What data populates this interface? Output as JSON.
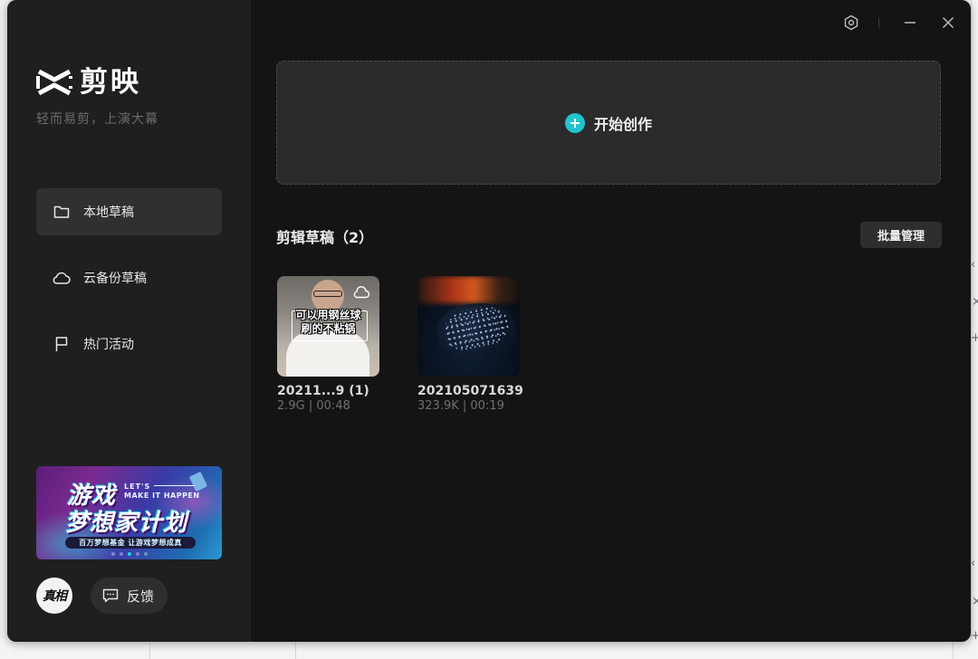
{
  "app": {
    "name": "剪映",
    "slogan": "轻而易剪，上演大幕"
  },
  "sidebar": {
    "items": [
      {
        "label": "本地草稿",
        "icon": "folder-icon",
        "active": true
      },
      {
        "label": "云备份草稿",
        "icon": "cloud-icon",
        "active": false
      },
      {
        "label": "热门活动",
        "icon": "flag-icon",
        "active": false
      }
    ],
    "banner": {
      "title_line1": "游戏",
      "title_line2": "梦想家计划",
      "english_line1": "LET'S",
      "english_line2": "MAKE IT HAPPEN",
      "tagline": "百万梦想基金  让游戏梦想成真",
      "slide_count": 5,
      "active_slide": 3
    },
    "avatar_text": "真相",
    "feedback_label": "反馈"
  },
  "titlebar": {
    "settings_icon": "settings-icon",
    "minimize_icon": "minimize-icon",
    "close_icon": "close-icon"
  },
  "main": {
    "create_label": "开始创作",
    "section_title": "剪辑草稿（2）",
    "batch_label": "批量管理",
    "drafts": [
      {
        "name": "20211...9 (1)",
        "meta": "2.9G | 00:48",
        "caption_line1": "可以用钢丝球",
        "caption_line2": "刷的不粘锅",
        "cloud": true
      },
      {
        "name": "202105071639",
        "meta": "323.9K | 00:19",
        "cloud": false
      }
    ]
  },
  "colors": {
    "accent": "#22c3d0",
    "window_bg": "#141414",
    "sidebar_bg": "#1f1f1f",
    "active_item_bg": "#303030"
  }
}
